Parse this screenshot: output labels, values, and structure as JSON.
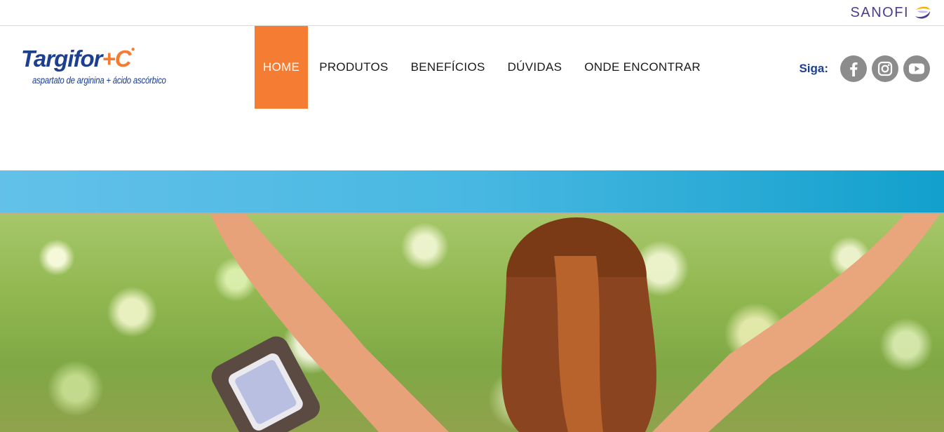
{
  "topbar": {
    "brand": "SANOFI",
    "brand_color": "#4b3f8c"
  },
  "header": {
    "logo": {
      "name": "Targifor",
      "plus": "+C",
      "subtitle": "aspartato de arginina + ácido ascórbico"
    },
    "nav": [
      {
        "label": "HOME",
        "active": true
      },
      {
        "label": "PRODUTOS",
        "active": false
      },
      {
        "label": "BENEFÍCIOS",
        "active": false
      },
      {
        "label": "DÚVIDAS",
        "active": false
      },
      {
        "label": "ONDE ENCONTRAR",
        "active": false
      }
    ],
    "social": {
      "label": "Siga:",
      "icons": [
        "facebook-icon",
        "instagram-icon",
        "youtube-icon"
      ]
    }
  },
  "colors": {
    "accent_orange": "#f47d33",
    "brand_blue": "#1d3f8f",
    "band_blue_start": "#63c1e9",
    "band_blue_end": "#12a0cc",
    "social_gray": "#8c8c8c"
  },
  "hero": {
    "image": "woman-raising-arms-outdoors-with-armband"
  }
}
